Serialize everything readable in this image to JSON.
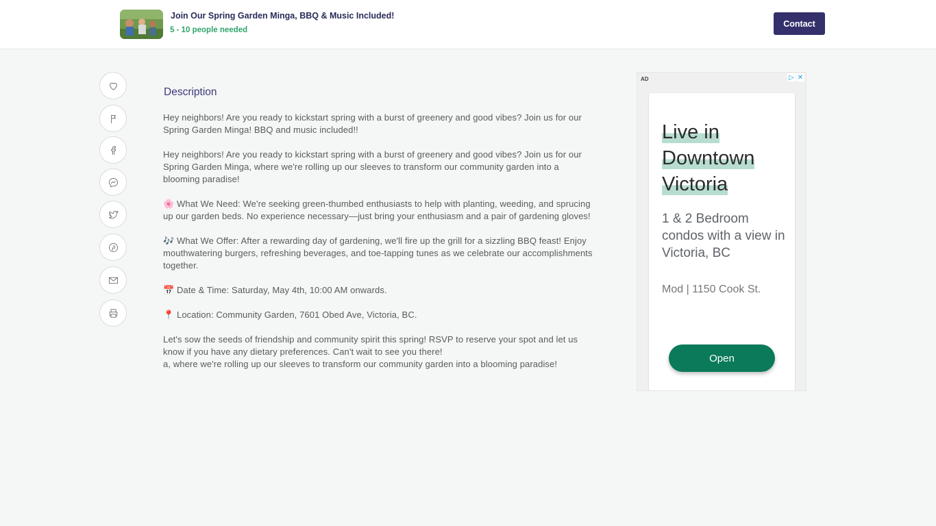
{
  "header": {
    "title": "Join Our Spring Garden Minga, BBQ & Music Included!",
    "people_needed": "5 - 10 people needed",
    "contact_label": "Contact"
  },
  "share": {
    "icons": [
      "heart-icon",
      "flag-icon",
      "facebook-icon",
      "messenger-icon",
      "twitter-icon",
      "pinterest-icon",
      "mail-icon",
      "print-icon"
    ]
  },
  "description": {
    "heading": "Description",
    "p1": "Hey neighbors! Are you ready to kickstart spring with a burst of greenery and good vibes? Join us for our Spring Garden Minga! BBQ and music included!!",
    "p2": "Hey neighbors! Are you ready to kickstart spring with a burst of greenery and good vibes? Join us for our Spring Garden Minga, where we're rolling up our sleeves to transform our community garden into a blooming paradise!",
    "p3": "🌸 What We Need: We're seeking green-thumbed enthusiasts to help with planting, weeding, and sprucing up our garden beds. No experience necessary—just bring your enthusiasm and a pair of gardening gloves!",
    "p4": "🎶 What We Offer: After a rewarding day of gardening, we'll fire up the grill for a sizzling BBQ feast! Enjoy mouthwatering burgers, refreshing beverages, and toe-tapping tunes as we celebrate our accomplishments together.",
    "p5": "📅 Date & Time: Saturday, May 4th, 10:00 AM onwards.",
    "p6": "📍 Location: Community Garden, 7601 Obed Ave, Victoria, BC.",
    "p7": "Let's sow the seeds of friendship and community spirit this spring! RSVP to reserve your spot and let us know if you have any dietary preferences. Can't wait to see you there!",
    "p8": "a, where we're rolling up our sleeves to transform our community garden into a blooming paradise!"
  },
  "ad": {
    "label": "AD",
    "headline_line1": "Live in",
    "headline_line2": "Downtown",
    "headline_line3": "Victoria",
    "subtext": "1 & 2 Bedroom condos with a view in Victoria, BC",
    "location": "Mod | 1150 Cook St.",
    "open_label": "Open"
  },
  "colors": {
    "brand_dark": "#33306b",
    "people_green": "#2fa56b",
    "ad_button": "#0a7a5a",
    "ad_highlight": "#b7ddd1"
  }
}
